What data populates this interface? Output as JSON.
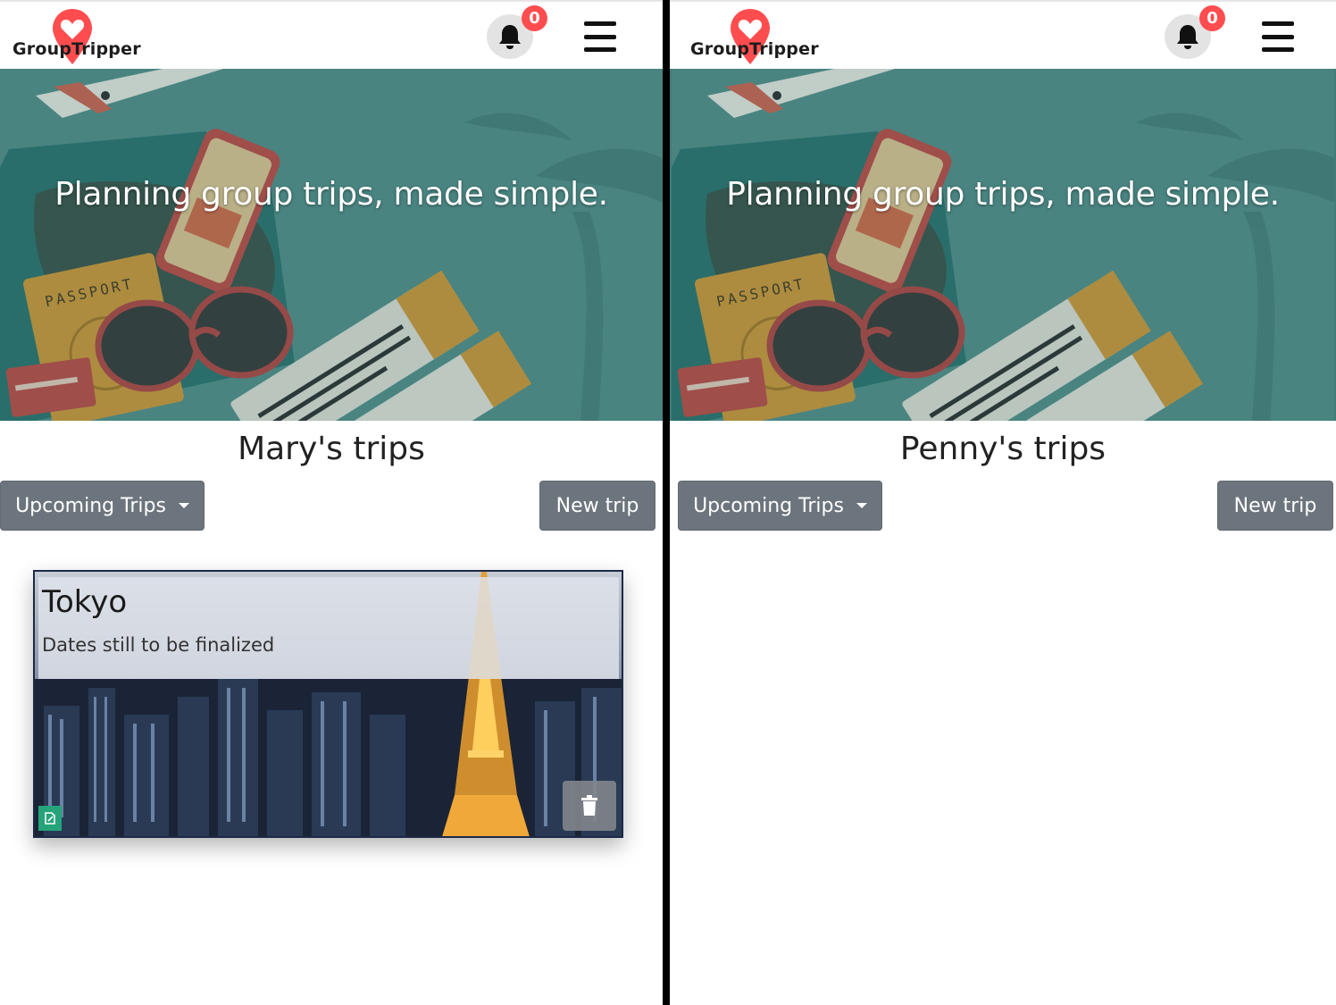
{
  "left": {
    "brand": "GroupTripper",
    "notifications": {
      "count": "0"
    },
    "hero": {
      "tagline": "Planning group trips, made simple."
    },
    "trips_title": "Mary's trips",
    "filter_button": "Upcoming Trips",
    "new_trip_button": "New trip",
    "trips": [
      {
        "name": "Tokyo",
        "dates": "Dates still to be finalized"
      }
    ]
  },
  "right": {
    "brand": "GroupTripper",
    "notifications": {
      "count": "0"
    },
    "hero": {
      "tagline": "Planning group trips, made simple."
    },
    "trips_title": "Penny's trips",
    "filter_button": "Upcoming Trips",
    "new_trip_button": "New trip",
    "trips": []
  },
  "colors": {
    "brand_pin": "#ff4d4f",
    "button_gray": "#6c757d",
    "badge": "#ff4d4f",
    "edit_green": "#25a47a"
  },
  "icons": {
    "logo": "map-pin-heart-icon",
    "notifications": "bell-icon",
    "menu": "hamburger-menu-icon",
    "dropdown": "caret-down-icon",
    "edit": "edit-icon",
    "delete": "trash-icon"
  }
}
